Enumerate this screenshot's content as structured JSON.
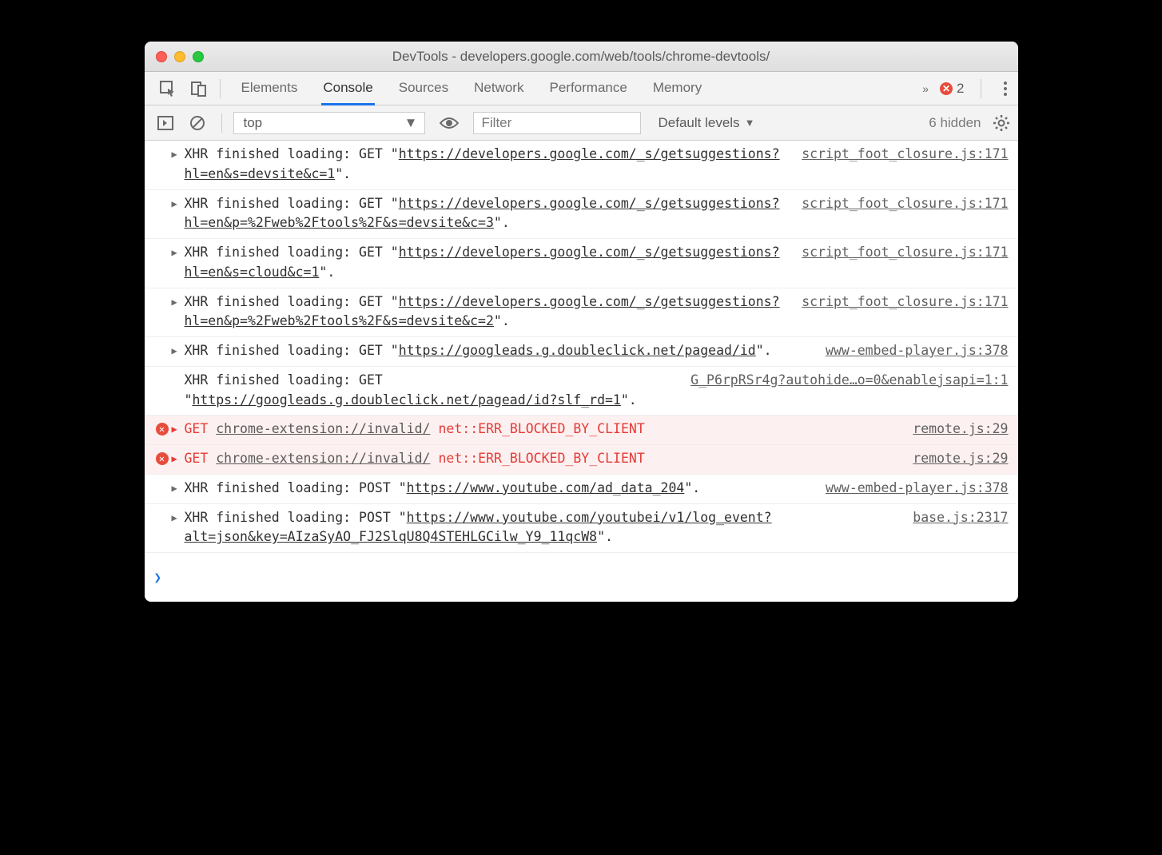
{
  "window": {
    "title": "DevTools - developers.google.com/web/tools/chrome-devtools/"
  },
  "tabbar": {
    "tabs": [
      "Elements",
      "Console",
      "Sources",
      "Network",
      "Performance",
      "Memory"
    ],
    "active": "Console",
    "overflow_glyph": "»",
    "error_count": "2"
  },
  "toolbar": {
    "context": "top",
    "filter_placeholder": "Filter",
    "levels_label": "Default levels",
    "hidden_label": "6 hidden"
  },
  "messages": [
    {
      "type": "log",
      "disclose": true,
      "prefix": "XHR finished loading: GET \"",
      "url": "https://developers.google.com/_s/getsuggestions?hl=en&s=devsite&c=1",
      "suffix": "\".",
      "source": "script_foot_closure.js:171"
    },
    {
      "type": "log",
      "disclose": true,
      "prefix": "XHR finished loading: GET \"",
      "url": "https://developers.google.com/_s/getsuggestions?hl=en&p=%2Fweb%2Ftools%2F&s=devsite&c=3",
      "suffix": "\".",
      "source": "script_foot_closure.js:171"
    },
    {
      "type": "log",
      "disclose": true,
      "prefix": "XHR finished loading: GET \"",
      "url": "https://developers.google.com/_s/getsuggestions?hl=en&s=cloud&c=1",
      "suffix": "\".",
      "source": "script_foot_closure.js:171"
    },
    {
      "type": "log",
      "disclose": true,
      "prefix": "XHR finished loading: GET \"",
      "url": "https://developers.google.com/_s/getsuggestions?hl=en&p=%2Fweb%2Ftools%2F&s=devsite&c=2",
      "suffix": "\".",
      "source": "script_foot_closure.js:171"
    },
    {
      "type": "log",
      "disclose": true,
      "prefix": "XHR finished loading: GET \"",
      "url": "https://googleads.g.doubleclick.net/pagead/id",
      "suffix": "\".",
      "source": "www-embed-player.js:378"
    },
    {
      "type": "log",
      "disclose": false,
      "prefix": "XHR finished loading: GET \"",
      "url": "https://googleads.g.doubleclick.net/pagead/id?slf_rd=1",
      "suffix": "\".",
      "source": "G_P6rpRSr4g?autohide…o=0&enablejsapi=1:1"
    },
    {
      "type": "error",
      "disclose": true,
      "method": "GET",
      "err_url": "chrome-extension://invalid/",
      "err_msg": "net::ERR_BLOCKED_BY_CLIENT",
      "source": "remote.js:29"
    },
    {
      "type": "error",
      "disclose": true,
      "method": "GET",
      "err_url": "chrome-extension://invalid/",
      "err_msg": "net::ERR_BLOCKED_BY_CLIENT",
      "source": "remote.js:29"
    },
    {
      "type": "log",
      "disclose": true,
      "prefix": "XHR finished loading: POST \"",
      "url": "https://www.youtube.com/ad_data_204",
      "suffix": "\".",
      "source": "www-embed-player.js:378"
    },
    {
      "type": "log",
      "disclose": true,
      "prefix": "XHR finished loading: POST \"",
      "url": "https://www.youtube.com/youtubei/v1/log_event?alt=json&key=AIzaSyAO_FJ2SlqU8Q4STEHLGCilw_Y9_11qcW8",
      "suffix": "\".",
      "source": "base.js:2317"
    }
  ]
}
